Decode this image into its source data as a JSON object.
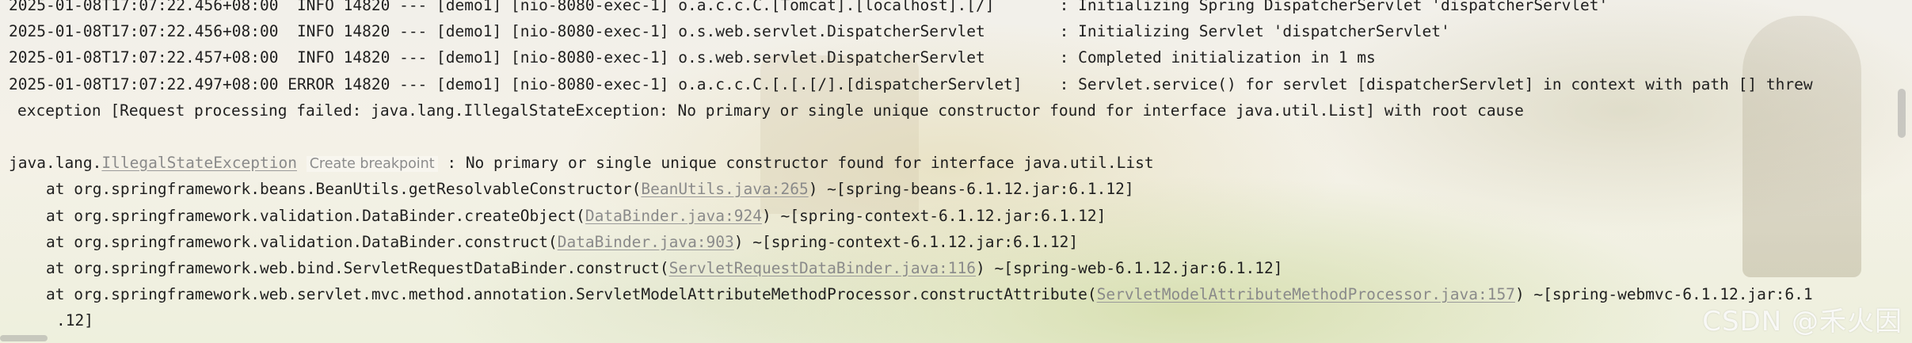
{
  "log_lines": [
    {
      "text": "2025-01-08T17:07:22.456+08:00  INFO 14820 --- [demo1] [nio-8080-exec-1] o.a.c.c.C.[Tomcat].[localhost].[/]       : Initializing Spring DispatcherServlet 'dispatcherServlet'"
    },
    {
      "text": "2025-01-08T17:07:22.456+08:00  INFO 14820 --- [demo1] [nio-8080-exec-1] o.s.web.servlet.DispatcherServlet        : Initializing Servlet 'dispatcherServlet'"
    },
    {
      "text": "2025-01-08T17:07:22.457+08:00  INFO 14820 --- [demo1] [nio-8080-exec-1] o.s.web.servlet.DispatcherServlet        : Completed initialization in 1 ms"
    },
    {
      "text": "2025-01-08T17:07:22.497+08:00 ERROR 14820 --- [demo1] [nio-8080-exec-1] o.a.c.c.C.[.[.[/].[dispatcherServlet]    : Servlet.service() for servlet [dispatcherServlet] in context with path [] threw"
    },
    {
      "text": "exception [Request processing failed: java.lang.IllegalStateException: No primary or single unique constructor found for interface java.util.List] with root cause"
    }
  ],
  "exception": {
    "prefix": "java.lang.",
    "name": "IllegalStateException",
    "hint": "Create breakpoint",
    "message": " : No primary or single unique constructor found for interface java.util.List"
  },
  "stack_trace": [
    {
      "before": "at org.springframework.beans.BeanUtils.getResolvableConstructor(",
      "link": "BeanUtils.java:265",
      "after": ") ~[spring-beans-6.1.12.jar:6.1.12]"
    },
    {
      "before": "at org.springframework.validation.DataBinder.createObject(",
      "link": "DataBinder.java:924",
      "after": ") ~[spring-context-6.1.12.jar:6.1.12]"
    },
    {
      "before": "at org.springframework.validation.DataBinder.construct(",
      "link": "DataBinder.java:903",
      "after": ") ~[spring-context-6.1.12.jar:6.1.12]"
    },
    {
      "before": "at org.springframework.web.bind.ServletRequestDataBinder.construct(",
      "link": "ServletRequestDataBinder.java:116",
      "after": ") ~[spring-web-6.1.12.jar:6.1.12]"
    },
    {
      "before": "at org.springframework.web.servlet.mvc.method.annotation.ServletModelAttributeMethodProcessor.constructAttribute(",
      "link": "ServletModelAttributeMethodProcessor.java:157",
      "after": ") ~[spring-webmvc-6.1.12.jar:6.1"
    }
  ],
  "stack_trace_wrap": ".12]",
  "watermark": "CSDN @禾火因"
}
